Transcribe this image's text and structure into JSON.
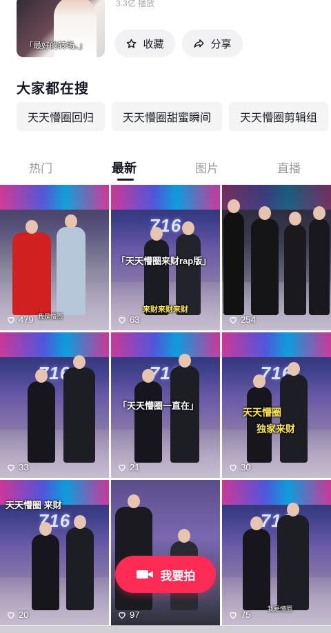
{
  "top_card": {
    "thumbnail_caption": "「最好的转场。」",
    "partial_text": "3.3亿 播放",
    "collect_label": "收藏",
    "share_label": "分享"
  },
  "search_section": {
    "title": "大家都在搜",
    "chips": [
      "天天懵圈回归",
      "天天懵圈甜蜜瞬间",
      "天天懵圈剪辑组"
    ]
  },
  "tabs": [
    "热门",
    "最新",
    "图片",
    "直播"
  ],
  "active_tab": "最新",
  "videos": [
    {
      "likes": "479",
      "caption": "我是懵圈"
    },
    {
      "likes": "63",
      "caption": "「天天懵圈来财rap版」",
      "caption2": "来财来财来财"
    },
    {
      "likes": "254",
      "caption": ""
    },
    {
      "likes": "33",
      "caption": ""
    },
    {
      "likes": "21",
      "caption": "「天天懵圈一直在」"
    },
    {
      "likes": "30",
      "caption": "天天懵圈",
      "caption2": "独家来财"
    },
    {
      "likes": "20",
      "caption": "天天懵圈 来财"
    },
    {
      "likes": "97",
      "caption": ""
    },
    {
      "likes": "75",
      "caption": "我是懵圈"
    }
  ],
  "shoot_button_label": "我要拍",
  "colors": {
    "accent": "#fe2c55",
    "text": "#161823",
    "chip_bg": "#f4f4f5"
  }
}
